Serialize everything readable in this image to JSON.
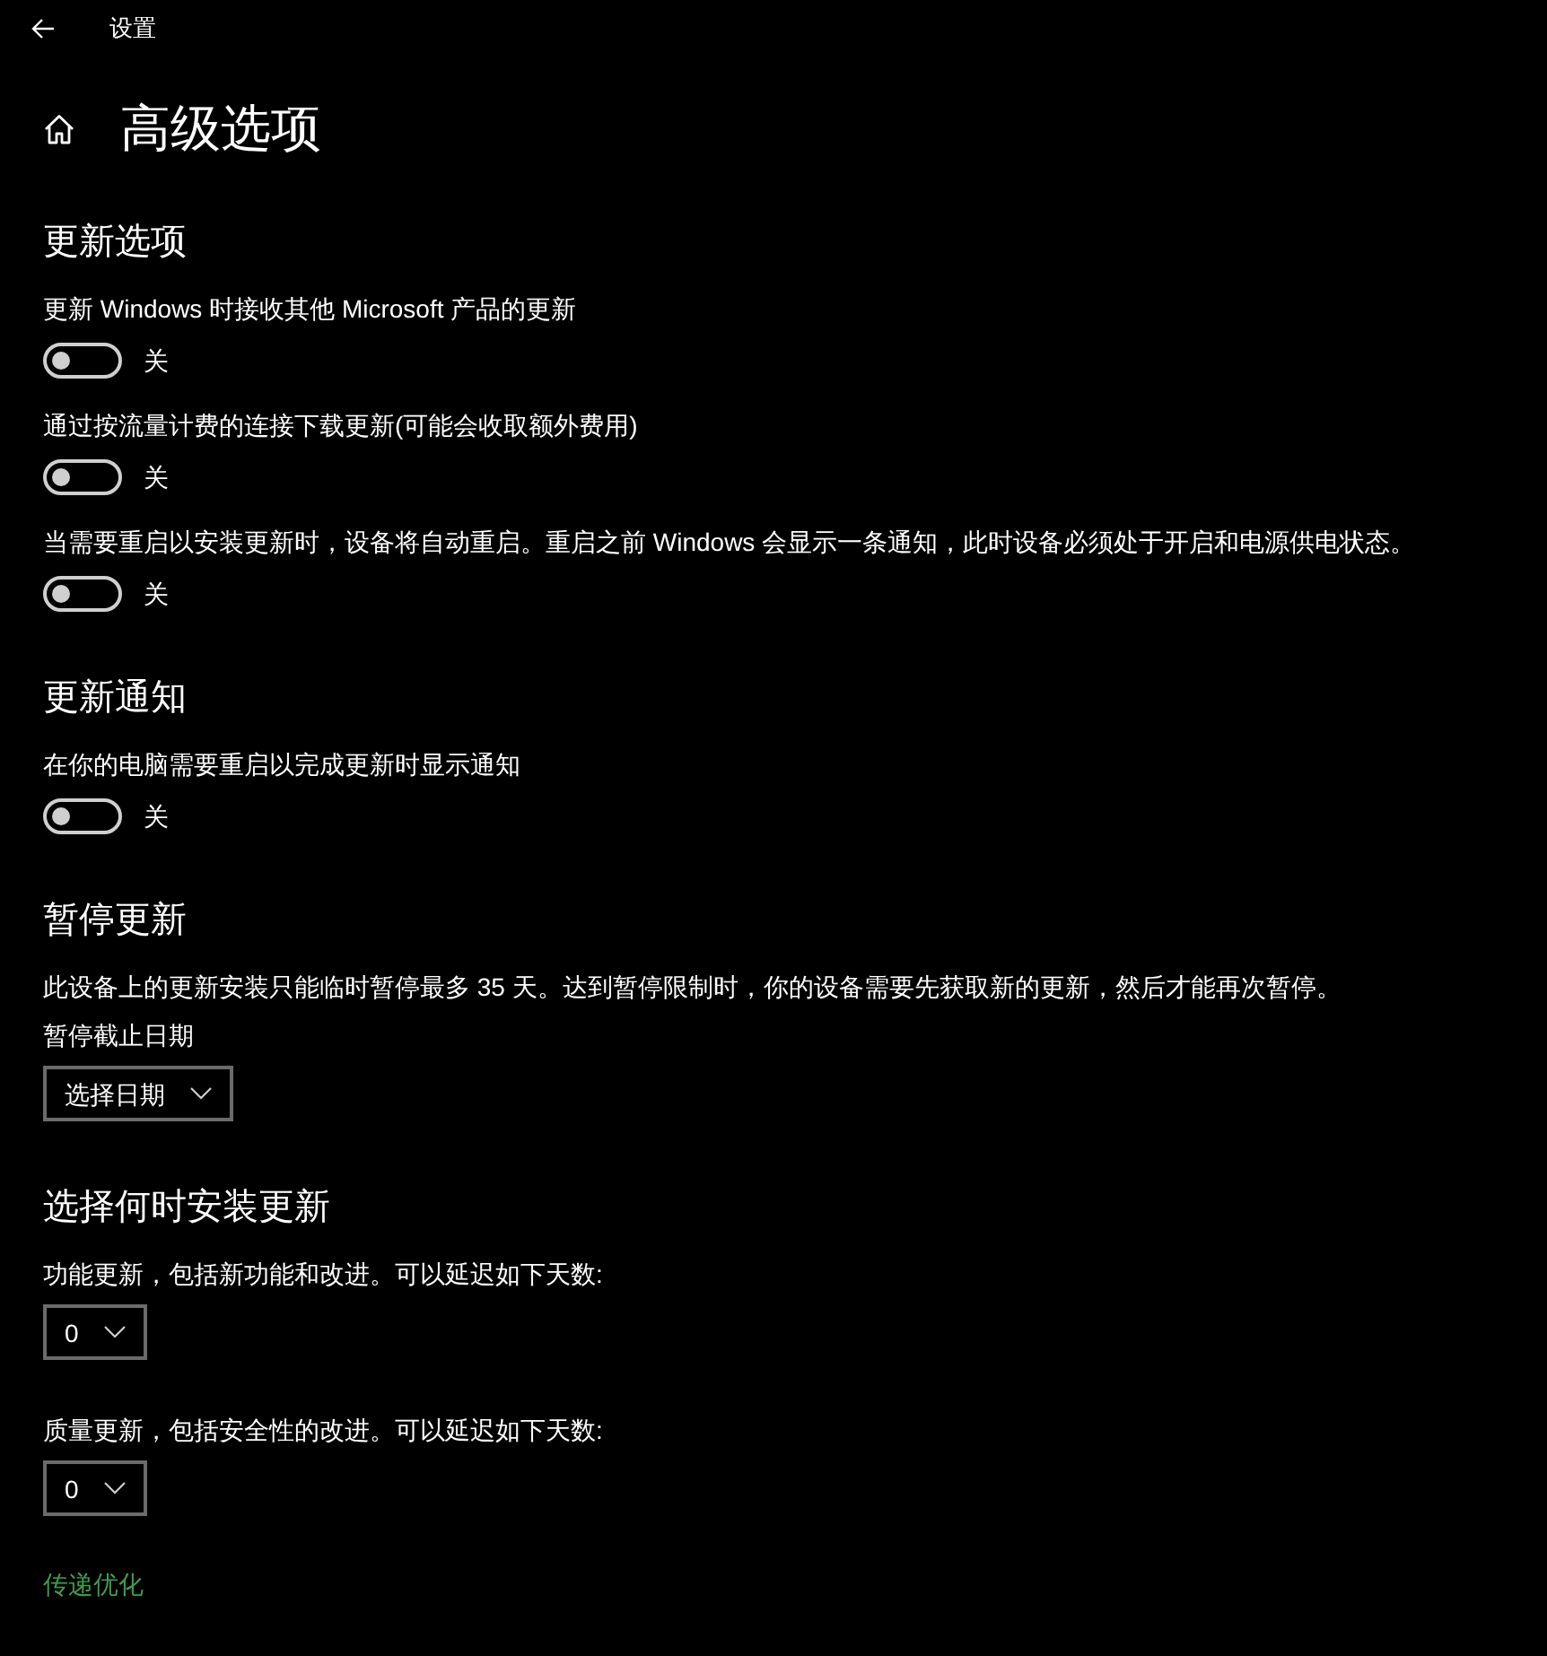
{
  "top_bar": {
    "title": "设置"
  },
  "page": {
    "title": "高级选项"
  },
  "sections": [
    {
      "heading": "更新选项",
      "items": [
        {
          "kind": "toggle",
          "label": "更新 Windows 时接收其他 Microsoft 产品的更新",
          "on": false,
          "state_text": "关"
        },
        {
          "kind": "toggle",
          "label": "通过按流量计费的连接下载更新(可能会收取额外费用)",
          "on": false,
          "state_text": "关"
        },
        {
          "kind": "toggle",
          "label": "当需要重启以安装更新时，设备将自动重启。重启之前 Windows 会显示一条通知，此时设备必须处于开启和电源供电状态。",
          "on": false,
          "state_text": "关"
        }
      ]
    },
    {
      "heading": "更新通知",
      "items": [
        {
          "kind": "toggle",
          "label": "在你的电脑需要重启以完成更新时显示通知",
          "on": false,
          "state_text": "关"
        }
      ]
    },
    {
      "heading": "暂停更新",
      "items": [
        {
          "kind": "text",
          "text": "此设备上的更新安装只能临时暂停最多 35 天。达到暂停限制时，你的设备需要先获取新的更新，然后才能再次暂停。"
        },
        {
          "kind": "dropdown",
          "label": "暂停截止日期",
          "value": "选择日期"
        }
      ]
    },
    {
      "heading": "选择何时安装更新",
      "items": [
        {
          "kind": "dropdown",
          "label": "功能更新，包括新功能和改进。可以延迟如下天数:",
          "value": "0"
        },
        {
          "kind": "dropdown",
          "label": "质量更新，包括安全性的改进。可以延迟如下天数:",
          "value": "0"
        }
      ]
    }
  ],
  "link": "传递优化"
}
